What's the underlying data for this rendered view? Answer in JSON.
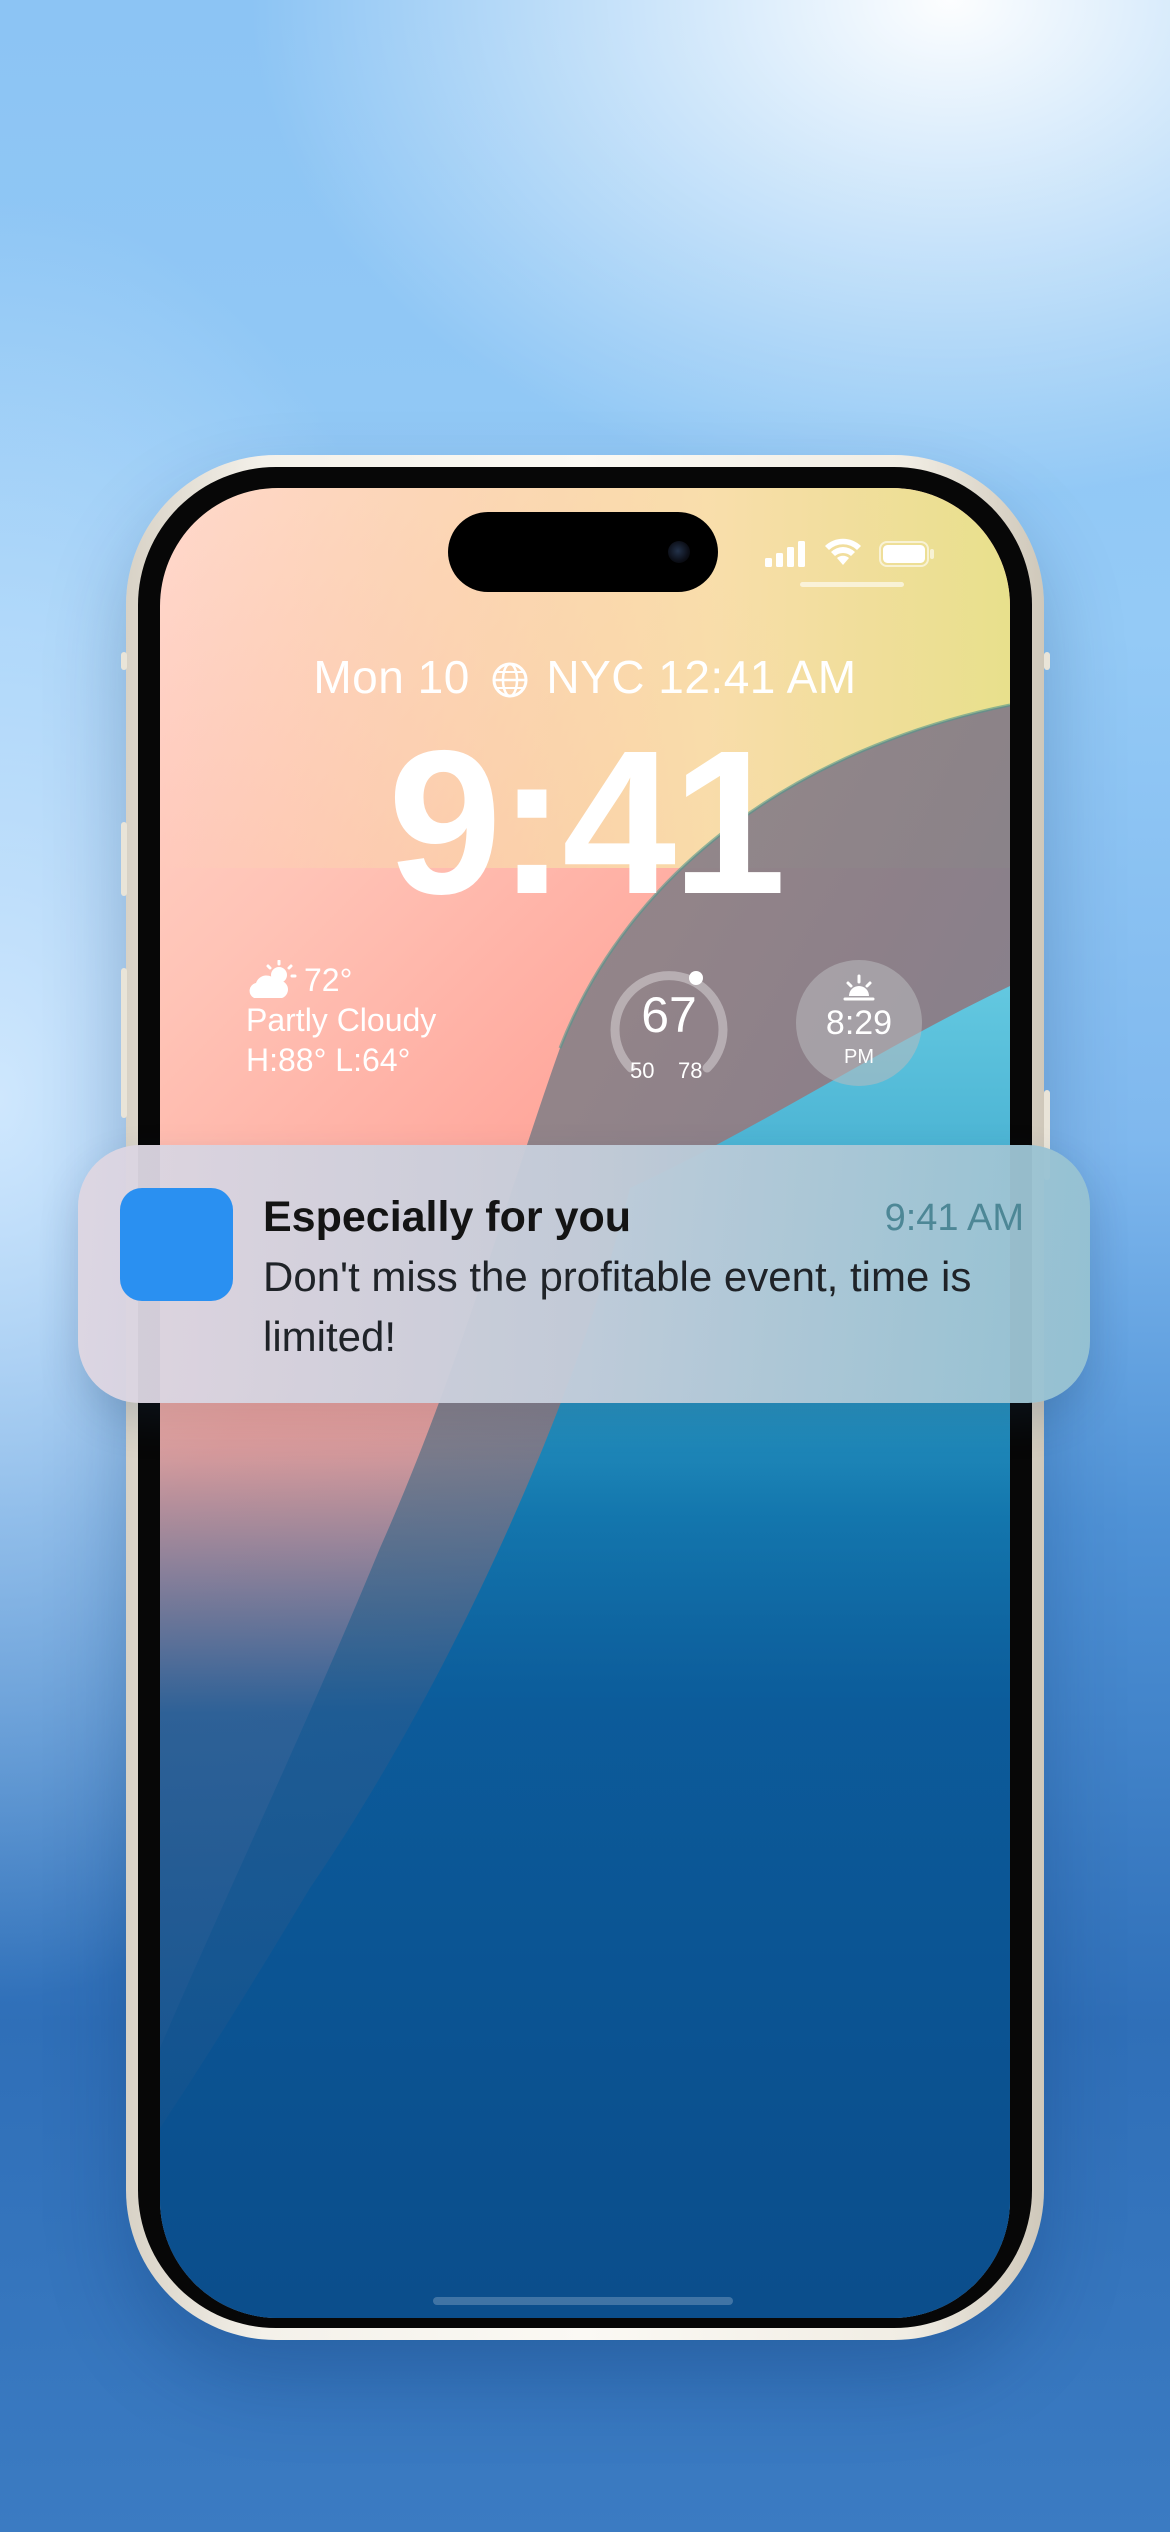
{
  "status_bar": {
    "icons": [
      "signal-icon",
      "wifi-icon",
      "battery-icon"
    ]
  },
  "lock_screen": {
    "date_line": {
      "date": "Mon 10",
      "city_time": "NYC 12:41 AM"
    },
    "time": "9:41",
    "weather": {
      "temp": "72°",
      "condition": "Partly Cloudy",
      "high_low": "H:88° L:64°"
    },
    "gauge": {
      "value": "67",
      "low": "50",
      "high": "78"
    },
    "sunset": {
      "time": "8:29",
      "meridiem": "PM"
    }
  },
  "notification": {
    "title": "Especially for you",
    "time": "9:41 AM",
    "body": "Don't miss the profitable event, time is limited!",
    "app_icon_color": "#2a90f1"
  },
  "colors": {
    "accent": "#2a90f1",
    "background_blue": "#4f92d6"
  }
}
